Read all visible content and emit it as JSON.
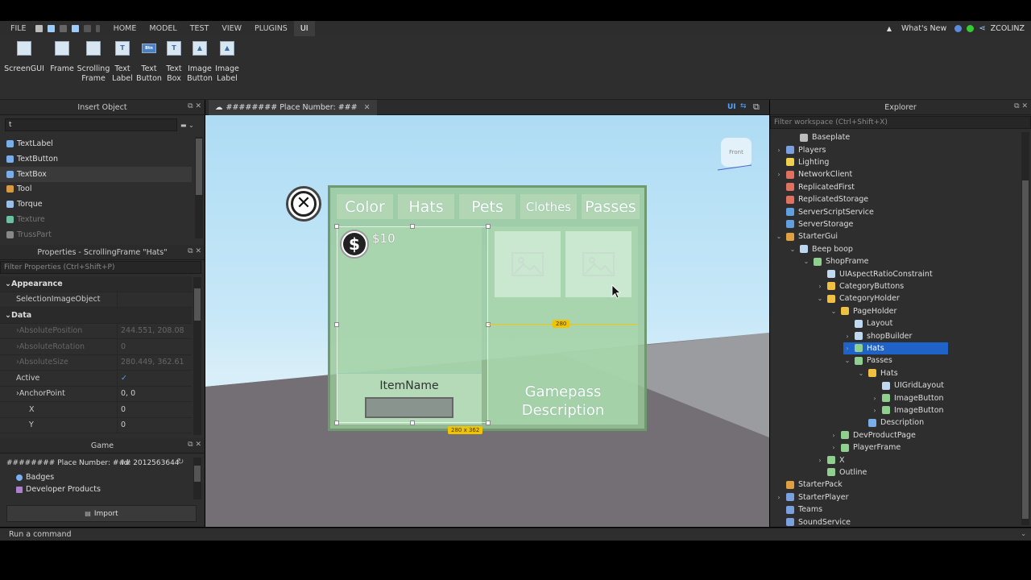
{
  "menu": {
    "file": "FILE",
    "tabs": [
      "HOME",
      "MODEL",
      "TEST",
      "VIEW",
      "PLUGINS",
      "UI"
    ],
    "active_tab": "UI",
    "whats_new": "What's New",
    "username": "ZCOLINZ"
  },
  "ribbon": {
    "items": [
      {
        "label": "ScreenGUI",
        "icon": "screengui-icon"
      },
      {
        "label": "Frame",
        "icon": "frame-icon"
      },
      {
        "label": "Scrolling\nFrame",
        "icon": "scrolling-frame-icon"
      },
      {
        "label": "Text\nLabel",
        "icon": "text-label-icon"
      },
      {
        "label": "Text\nButton",
        "icon": "text-button-icon"
      },
      {
        "label": "Text\nBox",
        "icon": "text-box-icon"
      },
      {
        "label": "Image\nButton",
        "icon": "image-button-icon"
      },
      {
        "label": "Image\nLabel",
        "icon": "image-label-icon"
      }
    ]
  },
  "insert_object": {
    "title": "Insert Object",
    "search_value": "t",
    "items": [
      {
        "label": "TextLabel",
        "color": "#7aaee8"
      },
      {
        "label": "TextButton",
        "color": "#7aaee8"
      },
      {
        "label": "TextBox",
        "color": "#7aaee8"
      },
      {
        "label": "Tool",
        "color": "#d89a40"
      },
      {
        "label": "Torque",
        "color": "#9ac0e8"
      },
      {
        "label": "Texture",
        "color": "#6ac0a0"
      },
      {
        "label": "TrussPart",
        "color": "#888888"
      }
    ]
  },
  "properties": {
    "title": "Properties - ScrollingFrame \"Hats\"",
    "filter_placeholder": "Filter Properties (Ctrl+Shift+P)",
    "rows": [
      {
        "type": "cat",
        "name": "Appearance"
      },
      {
        "type": "prop",
        "name": "SelectionImageObject",
        "value": ""
      },
      {
        "type": "cat",
        "name": "Data"
      },
      {
        "type": "dim",
        "name": "AbsolutePosition",
        "value": "244.551, 208.08"
      },
      {
        "type": "dim",
        "name": "AbsoluteRotation",
        "value": "0"
      },
      {
        "type": "dim",
        "name": "AbsoluteSize",
        "value": "280.449, 362.61"
      },
      {
        "type": "prop",
        "name": "Active",
        "value": "✓"
      },
      {
        "type": "prop",
        "name": "AnchorPoint",
        "value": "0, 0"
      },
      {
        "type": "sub",
        "name": "X",
        "value": "0"
      },
      {
        "type": "sub",
        "name": "Y",
        "value": "0"
      }
    ]
  },
  "game": {
    "title": "Game",
    "place": "######## Place Number: ###",
    "id": "Id: 2012563644",
    "items": [
      "Badges",
      "Developer Products"
    ],
    "import_label": "Import"
  },
  "viewport": {
    "tab_title": "######## Place Number: ###",
    "ui_label": "UI",
    "cube_label": "Front",
    "shop": {
      "category_buttons": [
        "Color",
        "Hats",
        "Pets",
        "Clothes",
        "Passes"
      ],
      "price": "$10",
      "item_name": "ItemName",
      "gamepass_description": "Gamepass\nDescription",
      "width_badge": "280",
      "size_badge": "280 x 362"
    }
  },
  "explorer": {
    "title": "Explorer",
    "filter_placeholder": "Filter workspace (Ctrl+Shift+X)",
    "nodes": [
      {
        "label": "Baseplate",
        "depth": 1,
        "arrow": "",
        "color": "#bbbbbb"
      },
      {
        "label": "Players",
        "depth": 0,
        "arrow": "›",
        "color": "#7aa0e0"
      },
      {
        "label": "Lighting",
        "depth": 0,
        "arrow": "",
        "color": "#f0d050"
      },
      {
        "label": "NetworkClient",
        "depth": 0,
        "arrow": "›",
        "color": "#e07060"
      },
      {
        "label": "ReplicatedFirst",
        "depth": 0,
        "arrow": "",
        "color": "#e07060"
      },
      {
        "label": "ReplicatedStorage",
        "depth": 0,
        "arrow": "",
        "color": "#e07060"
      },
      {
        "label": "ServerScriptService",
        "depth": 0,
        "arrow": "",
        "color": "#60a0e0"
      },
      {
        "label": "ServerStorage",
        "depth": 0,
        "arrow": "",
        "color": "#60a0e0"
      },
      {
        "label": "StarterGui",
        "depth": 0,
        "arrow": "⌄",
        "color": "#e0a040"
      },
      {
        "label": "Beep boop",
        "depth": 1,
        "arrow": "⌄",
        "color": "#bcd8f0"
      },
      {
        "label": "ShopFrame",
        "depth": 2,
        "arrow": "⌄",
        "color": "#8fd08f"
      },
      {
        "label": "UIAspectRatioConstraint",
        "depth": 3,
        "arrow": "",
        "color": "#c0d8f0"
      },
      {
        "label": "CategoryButtons",
        "depth": 3,
        "arrow": "›",
        "color": "#f0c040"
      },
      {
        "label": "CategoryHolder",
        "depth": 3,
        "arrow": "⌄",
        "color": "#f0c040"
      },
      {
        "label": "PageHolder",
        "depth": 4,
        "arrow": "⌄",
        "color": "#f0c040"
      },
      {
        "label": "Layout",
        "depth": 5,
        "arrow": "",
        "color": "#c0d8f0"
      },
      {
        "label": "shopBuilder",
        "depth": 5,
        "arrow": "›",
        "color": "#c0d8f0"
      },
      {
        "label": "Hats",
        "depth": 5,
        "arrow": "›",
        "color": "#8fd08f",
        "selected": true
      },
      {
        "label": "Passes",
        "depth": 5,
        "arrow": "⌄",
        "color": "#8fd08f"
      },
      {
        "label": "Hats",
        "depth": 6,
        "arrow": "⌄",
        "color": "#f0c040"
      },
      {
        "label": "UIGridLayout",
        "depth": 7,
        "arrow": "",
        "color": "#c0d8f0"
      },
      {
        "label": "ImageButton",
        "depth": 7,
        "arrow": "›",
        "color": "#8fd08f"
      },
      {
        "label": "ImageButton",
        "depth": 7,
        "arrow": "›",
        "color": "#8fd08f"
      },
      {
        "label": "Description",
        "depth": 6,
        "arrow": "",
        "color": "#7aaee8"
      },
      {
        "label": "DevProductPage",
        "depth": 4,
        "arrow": "›",
        "color": "#8fd08f"
      },
      {
        "label": "PlayerFrame",
        "depth": 4,
        "arrow": "›",
        "color": "#8fd08f"
      },
      {
        "label": "X",
        "depth": 3,
        "arrow": "›",
        "color": "#8fd08f"
      },
      {
        "label": "Outline",
        "depth": 3,
        "arrow": "",
        "color": "#8fd08f"
      },
      {
        "label": "StarterPack",
        "depth": 0,
        "arrow": "",
        "color": "#e0a040"
      },
      {
        "label": "StarterPlayer",
        "depth": 0,
        "arrow": "›",
        "color": "#7aa0e0"
      },
      {
        "label": "Teams",
        "depth": 0,
        "arrow": "",
        "color": "#7aa0e0"
      },
      {
        "label": "SoundService",
        "depth": 0,
        "arrow": "",
        "color": "#7aa0e0"
      }
    ]
  },
  "command_bar": {
    "placeholder": "Run a command"
  }
}
